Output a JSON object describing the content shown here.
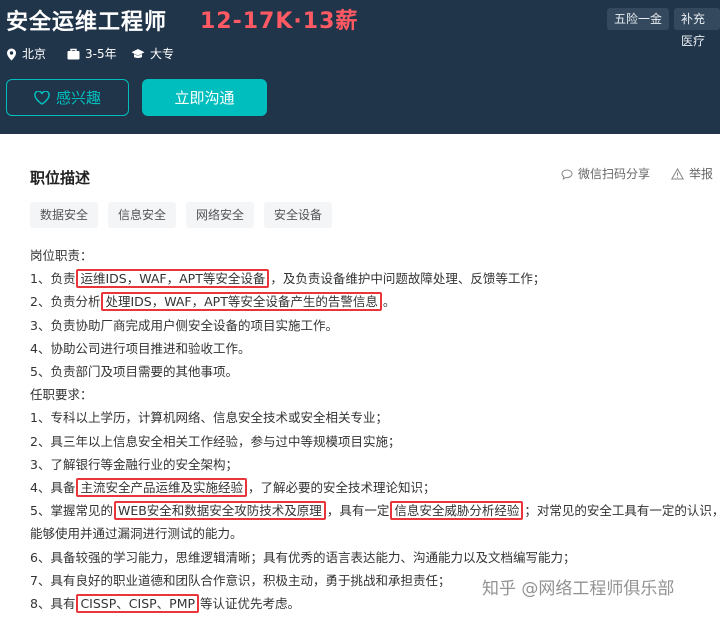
{
  "job": {
    "title": "安全运维工程师",
    "salary": "12-17K·13薪",
    "benefits": [
      "五险一金",
      "补充医疗"
    ],
    "location": "北京",
    "experience": "3-5年",
    "education": "大专"
  },
  "actions": {
    "interest": "感兴趣",
    "chat": "立即沟通"
  },
  "card": {
    "title": "职位描述",
    "share": "微信扫码分享",
    "report": "举报",
    "tags": [
      "数据安全",
      "信息安全",
      "网络安全",
      "安全设备"
    ]
  },
  "description": {
    "duties_heading": "岗位职责：",
    "d1": {
      "a": "1、负责",
      "h1": "运维IDS，WAF，APT等安全设备",
      "b": "，及负责设备维护中问题故障处理、反馈等工作；"
    },
    "d2": {
      "a": "2、负责分析",
      "h1": "处理IDS，WAF，APT等安全设备产生的告警信息",
      "b": "。"
    },
    "d3": "3、负责协助厂商完成用户侧安全设备的项目实施工作。",
    "d4": "4、协助公司进行项目推进和验收工作。",
    "d5": "5、负责部门及项目需要的其他事项。",
    "req_heading": "任职要求：",
    "r1": "1、专科以上学历，计算机网络、信息安全技术或安全相关专业；",
    "r2": "2、具三年以上信息安全相关工作经验，参与过中等规模项目实施；",
    "r3": "3、了解银行等金融行业的安全架构；",
    "r4": {
      "a": "4、具备",
      "h1": "主流安全产品运维及实施经验",
      "b": "，了解必要的安全技术理论知识；"
    },
    "r5": {
      "a": "5、掌握常见的",
      "h1": "WEB安全和数据安全攻防技术及原理",
      "b": "，具有一定",
      "h2": "信息安全威胁分析经验",
      "c": "；对常见的安全工具有一定的认识，有"
    },
    "r5_cont": "能够使用并通过漏洞进行测试的能力。",
    "r6": "6、具备较强的学习能力，思维逻辑清晰；具有优秀的语言表达能力、沟通能力以及文档编写能力；",
    "r7": "7、具有良好的职业道德和团队合作意识，积极主动，勇于挑战和承担责任；",
    "r8": {
      "a": "8、具有",
      "h1": "CISSP、CISP、PMP",
      "b": "等认证优先考虑。"
    }
  },
  "watermark": "知乎 @网络工程师俱乐部"
}
